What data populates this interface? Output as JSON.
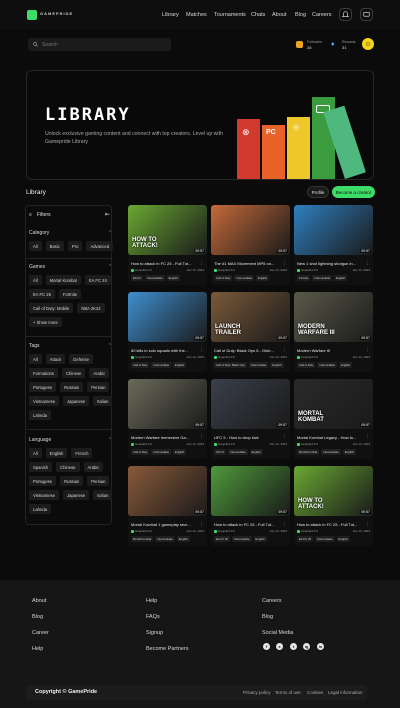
{
  "brand": {
    "name": "GAMEPRIDE"
  },
  "nav": [
    "Library",
    "Matches",
    "Tournaments",
    "Chats",
    "About",
    "Blog",
    "Careers"
  ],
  "search": {
    "placeholder": "Search"
  },
  "stats": [
    {
      "label": "Followers",
      "value": "28"
    },
    {
      "label": "Rewards",
      "value": "31"
    }
  ],
  "hero": {
    "title": "LIBRARY",
    "description": "Unlock exclusive gaming content and connect with top creators. Level up with Gamepride Library",
    "bar_labels": [
      "PC"
    ],
    "colors": [
      "#d23a2e",
      "#e8622a",
      "#f0c72a",
      "#3a9c3e",
      "#4fb87f"
    ]
  },
  "library": {
    "title": "Library",
    "profile_label": "Profile",
    "create_label": "Become a creator"
  },
  "filters": {
    "title": "Filters",
    "category": {
      "title": "Category",
      "chips": [
        "All",
        "Basic",
        "Pro",
        "Advanced"
      ]
    },
    "games": {
      "title": "Games",
      "chips": [
        "All",
        "Mortal Kombat",
        "EA FC 24",
        "EA FC 25",
        "Fortnite",
        "Call of Duty: Mobile",
        "NBA 2K24"
      ],
      "show_more": "+ Show more"
    },
    "tags": {
      "title": "Tags",
      "chips": [
        "All",
        "Attack",
        "Defense",
        "Formations",
        "Chinese",
        "Arabic",
        "Portugese",
        "Russian",
        "Persian",
        "Vietnamese",
        "Japanese",
        "Italian",
        "Lahnda"
      ]
    },
    "language": {
      "title": "Language",
      "chips": [
        "All",
        "English",
        "French",
        "Spanish",
        "Chinese",
        "Arabic",
        "Portugese",
        "Russian",
        "Persian",
        "Vietnamese",
        "Japanese",
        "Italian",
        "Lahnda"
      ]
    }
  },
  "cards": [
    {
      "title": "How to attack in FC 25 - Full Tut...",
      "author": "Gospikini FC",
      "date": "Jan 13, 2023",
      "tags": [
        "EA FC",
        "Intermediate",
        "English"
      ],
      "duration": "09:57",
      "thumb": "#6aa832",
      "overlay": "HOW TO ATTACK!"
    },
    {
      "title": "The #1 MAX Movement MP5 on...",
      "author": "Gospikini FC",
      "date": "Jan 13, 2023",
      "tags": [
        "Call of Duty",
        "Intermediate",
        "English"
      ],
      "duration": "09:57",
      "thumb": "#c56a3a",
      "overlay": ""
    },
    {
      "title": "New 1 shot lightning shotgun in...",
      "author": "Gospikini FC",
      "date": "Jan 13, 2023",
      "tags": [
        "Fortnite",
        "Intermediate",
        "English"
      ],
      "duration": "09:57",
      "thumb": "#2f7fc0",
      "overlay": ""
    },
    {
      "title": "60 kills in solo squads with the...",
      "author": "Gospikini FC",
      "date": "Jan 13, 2023",
      "tags": [
        "Call of Duty",
        "Intermediate",
        "English"
      ],
      "duration": "09:57",
      "thumb": "#3f8fd0",
      "overlay": ""
    },
    {
      "title": "Call of Duty: Black Ops 6 - Glob...",
      "author": "Gospikini FC",
      "date": "Jan 13, 2023",
      "tags": [
        "Call of Duty: Black Ops",
        "Intermediate",
        "English"
      ],
      "duration": "09:57",
      "thumb": "#7a5a3a",
      "overlay": "LAUNCH TRAILER"
    },
    {
      "title": "Modern Warfare III",
      "author": "Gospikini FC",
      "date": "Jan 13, 2023",
      "tags": [
        "Call of Duty",
        "Intermediate",
        "English"
      ],
      "duration": "09:57",
      "thumb": "#5a5a4a",
      "overlay": "MODERN WARFARE III"
    },
    {
      "title": "Modern Warfare Immersive Ga...",
      "author": "Gospikini FC",
      "date": "Jan 13, 2023",
      "tags": [
        "Call of Duty",
        "Intermediate",
        "English"
      ],
      "duration": "09:57",
      "thumb": "#6a6a5a",
      "overlay": ""
    },
    {
      "title": "UFC 5 - How to drop kick",
      "author": "Gospikini FC",
      "date": "Jan 13, 2023",
      "tags": [
        "UFC 5",
        "Intermediate",
        "English"
      ],
      "duration": "09:57",
      "thumb": "#3a3f4a",
      "overlay": ""
    },
    {
      "title": "Mortal Kombat Legacy - How to...",
      "author": "Gospikini FC",
      "date": "Jan 13, 2023",
      "tags": [
        "Mortal Kombat",
        "Intermediate",
        "English"
      ],
      "duration": "09:57",
      "thumb": "#2a2a2a",
      "overlay": "MORTAL KOMBAT"
    },
    {
      "title": "Mortal Kombat 1 gameplay secr...",
      "author": "Gospikini FC",
      "date": "Jan 13, 2023",
      "tags": [
        "Mortal Kombat",
        "Intermediate",
        "English"
      ],
      "duration": "09:57",
      "thumb": "#8a5a3a",
      "overlay": ""
    },
    {
      "title": "How to attack in FC 25 - Full Tut...",
      "author": "Gospikini FC",
      "date": "Jan 13, 2023",
      "tags": [
        "EA FC 25",
        "Intermediate",
        "English"
      ],
      "duration": "09:57",
      "thumb": "#4f9a3a",
      "overlay": ""
    },
    {
      "title": "How to attack in FC 25 - Full Tut...",
      "author": "Gospikini FC",
      "date": "Jan 13, 2023",
      "tags": [
        "EA FC 25",
        "Intermediate",
        "English"
      ],
      "duration": "09:57",
      "thumb": "#6aa832",
      "overlay": "HOW TO ATTACK!"
    }
  ],
  "footer": {
    "col1": [
      "About",
      "Blog",
      "Career",
      "Help"
    ],
    "col2": [
      "Help",
      "FAQs",
      "Signup",
      "Become Partners"
    ],
    "col3": [
      "Careers",
      "Blog",
      "Social Media"
    ],
    "social": [
      "f",
      "x",
      "t",
      "ig",
      "in"
    ],
    "copyright": "Copyright © GamePride",
    "legal": [
      "Privacy policy",
      "Terms of use",
      "Cookies",
      "Legal information"
    ]
  }
}
